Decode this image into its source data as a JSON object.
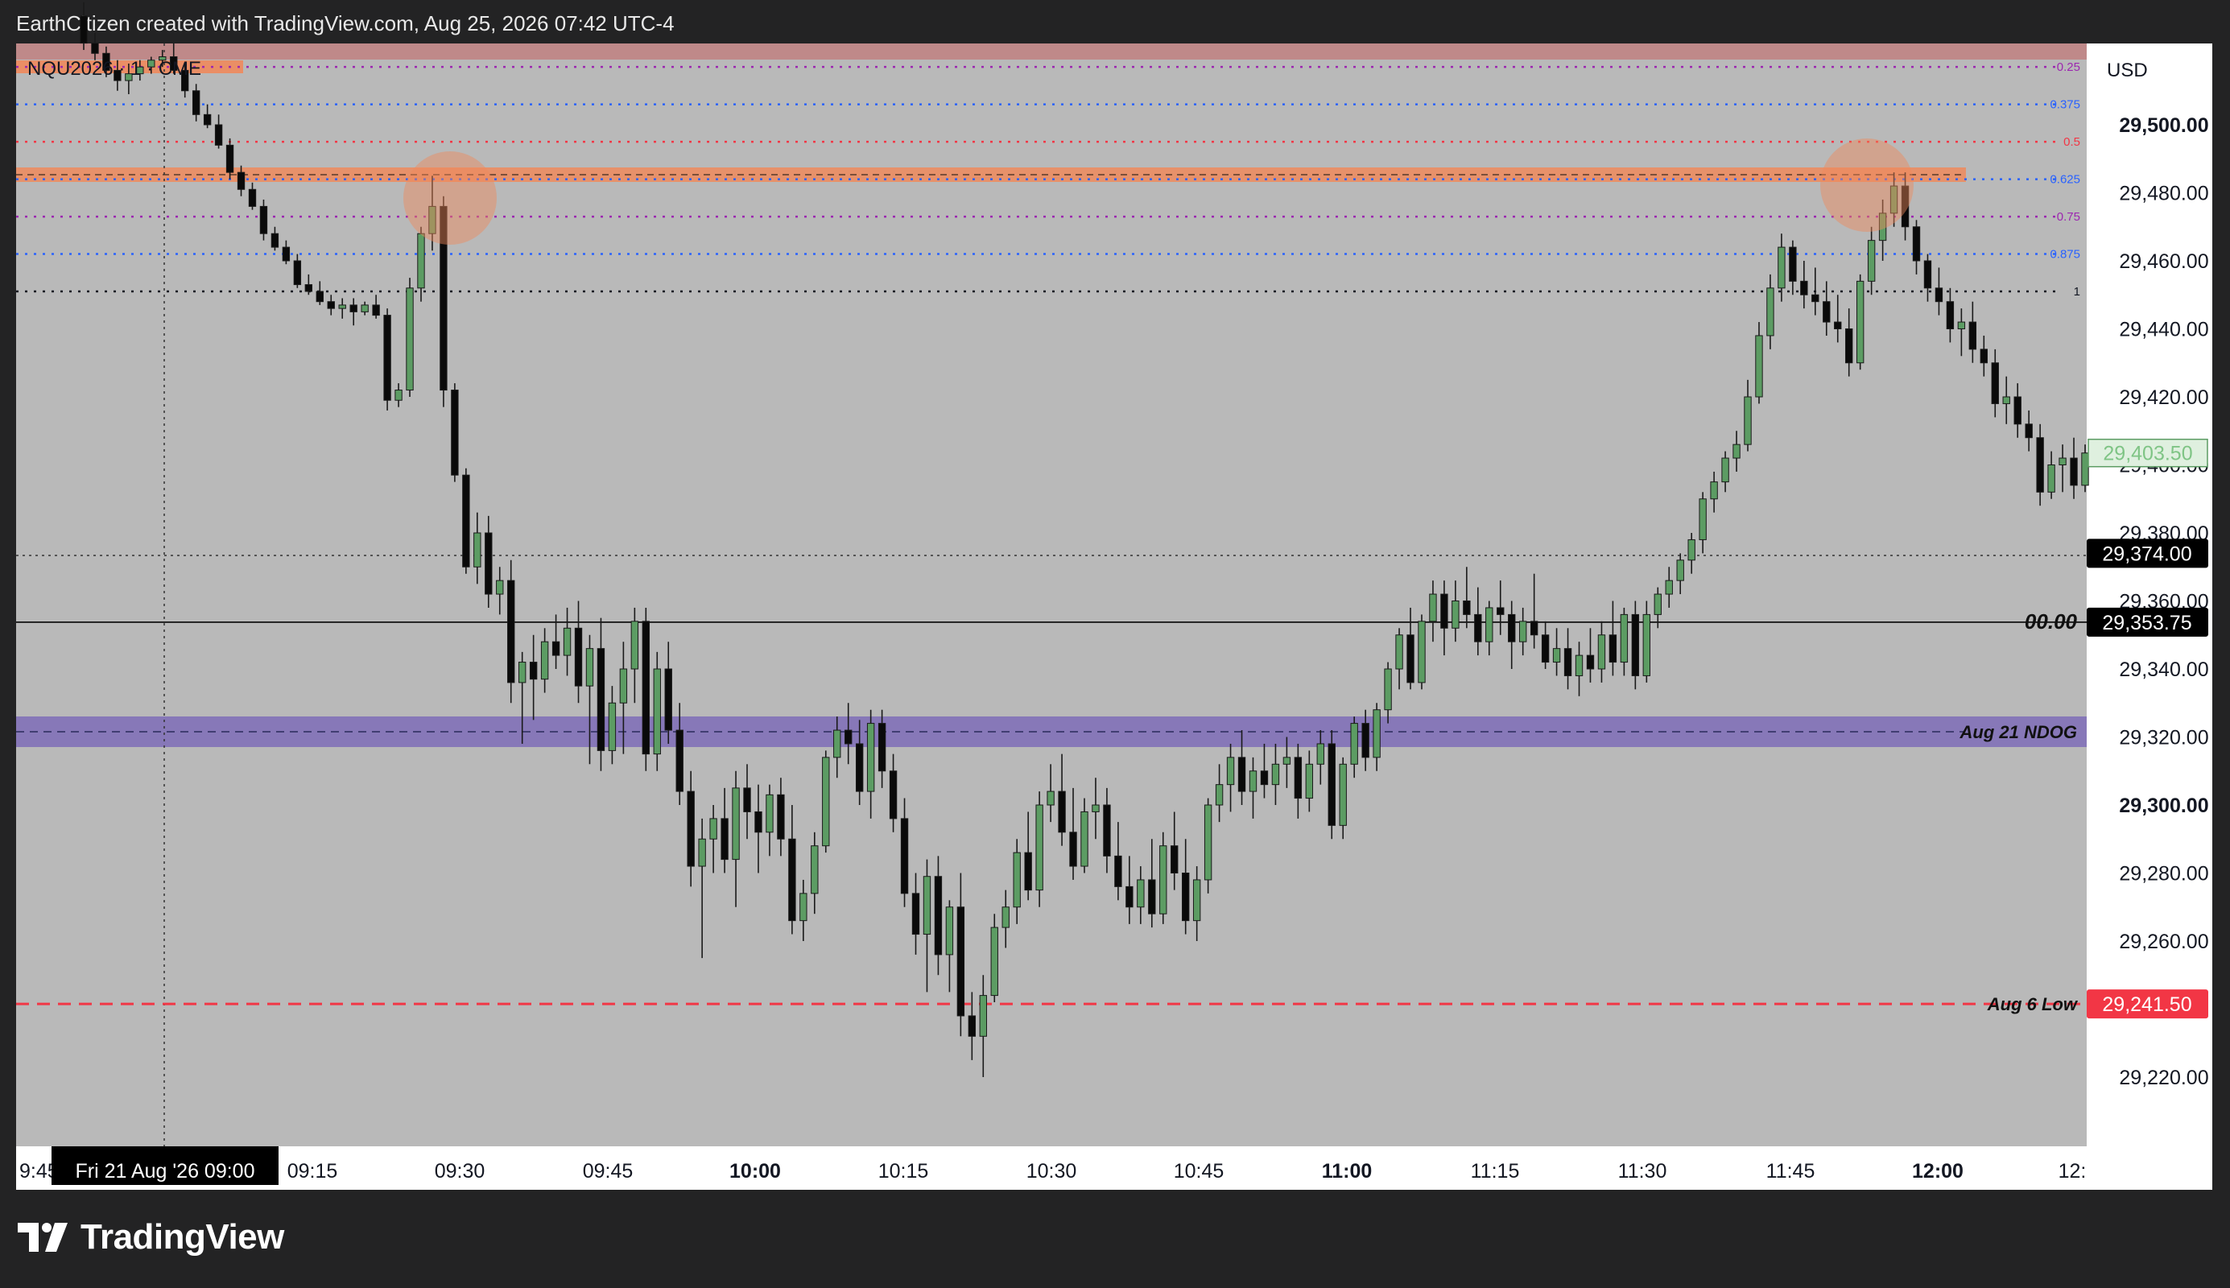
{
  "header": {
    "attribution": "EarthCitizen created with TradingView.com, Aug 25, 2026 07:42 UTC-4"
  },
  "symbol": {
    "label": "NQU2026 · 1 · CME"
  },
  "currency_button": {
    "label": "USD"
  },
  "brand": {
    "name": "TradingView"
  },
  "colors": {
    "bull": "#5c9c63",
    "bear": "#0a0a0a",
    "bg_plot": "#b9b9b9",
    "ndog": "#7a68b8",
    "aug6low": "#f23645",
    "orange_zone": "#ef8a5c",
    "top_zone": "#c08080"
  },
  "chart_data": {
    "type": "candlestick",
    "ylim": [
      29200,
      29535
    ],
    "x_labels": [
      "9:45",
      "Fri 21 Aug '26  09:00",
      "09:15",
      "09:30",
      "09:45",
      "10:00",
      "10:15",
      "10:30",
      "10:45",
      "11:00",
      "11:15",
      "11:30",
      "11:45",
      "12:00",
      "12:"
    ],
    "y_ticks": [
      "29,500.00",
      "29,480.00",
      "29,460.00",
      "29,440.00",
      "29,420.00",
      "29,400.00",
      "29,380.00",
      "29,360.00",
      "29,340.00",
      "29,320.00",
      "29,300.00",
      "29,280.00",
      "29,260.00",
      "29,220.00"
    ],
    "last_price": "29,403.50",
    "price_labels": [
      {
        "text": "29,374.00",
        "value": 29374.0,
        "style": "dark"
      },
      {
        "text": "29,353.75",
        "value": 29353.75,
        "style": "dark"
      },
      {
        "text": "29,241.50",
        "value": 29241.5,
        "style": "red"
      }
    ],
    "level_labels": [
      {
        "text": "00.00",
        "value": 29353.75
      },
      {
        "text": "Aug 21 NDOG",
        "value": 29321.5
      },
      {
        "text": "Aug 6 Low",
        "value": 29241.5
      }
    ],
    "fib_levels": [
      {
        "label": "0.25",
        "value": 29517,
        "color": "#9c27b0"
      },
      {
        "label": "0.375",
        "value": 29506,
        "color": "#2962ff"
      },
      {
        "label": "0.5",
        "value": 29495,
        "color": "#f23645"
      },
      {
        "label": "0.625",
        "value": 29484,
        "color": "#2962ff"
      },
      {
        "label": "0.75",
        "value": 29473,
        "color": "#9c27b0"
      },
      {
        "label": "0.875",
        "value": 29462,
        "color": "#2962ff"
      },
      {
        "label": "1",
        "value": 29451,
        "color": "#131722"
      }
    ],
    "candles": [
      [
        29532,
        29536,
        29522,
        29524
      ],
      [
        29524,
        29527,
        29519,
        29521
      ],
      [
        29521,
        29523,
        29514,
        29516
      ],
      [
        29516,
        29519,
        29510,
        29513
      ],
      [
        29513,
        29518,
        29509,
        29515
      ],
      [
        29515,
        29519,
        29513,
        29517
      ],
      [
        29517,
        29520,
        29515,
        29519
      ],
      [
        29519,
        29522,
        29517,
        29520
      ],
      [
        29520,
        29524,
        29515,
        29516
      ],
      [
        29516,
        29518,
        29508,
        29510
      ],
      [
        29510,
        29512,
        29501,
        29503
      ],
      [
        29503,
        29506,
        29499,
        29500
      ],
      [
        29500,
        29503,
        29493,
        29494
      ],
      [
        29494,
        29496,
        29484,
        29486
      ],
      [
        29486,
        29488,
        29479,
        29481
      ],
      [
        29481,
        29483,
        29475,
        29476
      ],
      [
        29476,
        29478,
        29466,
        29468
      ],
      [
        29468,
        29470,
        29463,
        29464
      ],
      [
        29464,
        29466,
        29459,
        29460
      ],
      [
        29460,
        29462,
        29452,
        29453
      ],
      [
        29453,
        29456,
        29450,
        29451
      ],
      [
        29451,
        29454,
        29447,
        29448
      ],
      [
        29448,
        29450,
        29444,
        29446
      ],
      [
        29446,
        29449,
        29443,
        29447
      ],
      [
        29447,
        29449,
        29441,
        29445
      ],
      [
        29445,
        29448,
        29444,
        29447
      ],
      [
        29447,
        29450,
        29443,
        29444
      ],
      [
        29444,
        29446,
        29416,
        29419
      ],
      [
        29419,
        29424,
        29417,
        29422
      ],
      [
        29422,
        29455,
        29420,
        29452
      ],
      [
        29452,
        29470,
        29448,
        29468
      ],
      [
        29468,
        29485,
        29463,
        29476
      ],
      [
        29476,
        29479,
        29417,
        29422
      ],
      [
        29422,
        29424,
        29395,
        29397
      ],
      [
        29397,
        29399,
        29368,
        29370
      ],
      [
        29370,
        29386,
        29365,
        29380
      ],
      [
        29380,
        29385,
        29358,
        29362
      ],
      [
        29362,
        29370,
        29356,
        29366
      ],
      [
        29366,
        29372,
        29330,
        29336
      ],
      [
        29336,
        29345,
        29318,
        29342
      ],
      [
        29342,
        29350,
        29325,
        29337
      ],
      [
        29337,
        29352,
        29333,
        29348
      ],
      [
        29348,
        29356,
        29340,
        29344
      ],
      [
        29344,
        29358,
        29338,
        29352
      ],
      [
        29352,
        29360,
        29330,
        29335
      ],
      [
        29335,
        29350,
        29312,
        29346
      ],
      [
        29346,
        29355,
        29310,
        29316
      ],
      [
        29316,
        29335,
        29312,
        29330
      ],
      [
        29330,
        29348,
        29315,
        29340
      ],
      [
        29340,
        29358,
        29330,
        29354
      ],
      [
        29354,
        29358,
        29310,
        29315
      ],
      [
        29315,
        29345,
        29310,
        29340
      ],
      [
        29340,
        29348,
        29318,
        29322
      ],
      [
        29322,
        29330,
        29300,
        29304
      ],
      [
        29304,
        29310,
        29276,
        29282
      ],
      [
        29282,
        29296,
        29255,
        29290
      ],
      [
        29290,
        29300,
        29280,
        29296
      ],
      [
        29296,
        29305,
        29280,
        29284
      ],
      [
        29284,
        29310,
        29270,
        29305
      ],
      [
        29305,
        29312,
        29290,
        29298
      ],
      [
        29298,
        29306,
        29280,
        29292
      ],
      [
        29292,
        29306,
        29285,
        29303
      ],
      [
        29303,
        29308,
        29285,
        29290
      ],
      [
        29290,
        29300,
        29262,
        29266
      ],
      [
        29266,
        29278,
        29260,
        29274
      ],
      [
        29274,
        29292,
        29268,
        29288
      ],
      [
        29288,
        29316,
        29286,
        29314
      ],
      [
        29314,
        29326,
        29308,
        29322
      ],
      [
        29322,
        29330,
        29312,
        29318
      ],
      [
        29318,
        29325,
        29300,
        29304
      ],
      [
        29304,
        29328,
        29296,
        29324
      ],
      [
        29324,
        29328,
        29305,
        29310
      ],
      [
        29310,
        29315,
        29292,
        29296
      ],
      [
        29296,
        29302,
        29270,
        29274
      ],
      [
        29274,
        29280,
        29256,
        29262
      ],
      [
        29262,
        29284,
        29245,
        29279
      ],
      [
        29279,
        29285,
        29250,
        29256
      ],
      [
        29256,
        29272,
        29245,
        29270
      ],
      [
        29270,
        29280,
        29232,
        29238
      ],
      [
        29238,
        29245,
        29225,
        29232
      ],
      [
        29232,
        29250,
        29220,
        29244
      ],
      [
        29244,
        29268,
        29242,
        29264
      ],
      [
        29264,
        29275,
        29258,
        29270
      ],
      [
        29270,
        29290,
        29265,
        29286
      ],
      [
        29286,
        29298,
        29272,
        29275
      ],
      [
        29275,
        29304,
        29270,
        29300
      ],
      [
        29300,
        29312,
        29295,
        29304
      ],
      [
        29304,
        29315,
        29288,
        29292
      ],
      [
        29292,
        29305,
        29278,
        29282
      ],
      [
        29282,
        29302,
        29280,
        29298
      ],
      [
        29298,
        29308,
        29290,
        29300
      ],
      [
        29300,
        29305,
        29280,
        29285
      ],
      [
        29285,
        29295,
        29272,
        29276
      ],
      [
        29276,
        29285,
        29265,
        29270
      ],
      [
        29270,
        29282,
        29265,
        29278
      ],
      [
        29278,
        29290,
        29264,
        29268
      ],
      [
        29268,
        29292,
        29265,
        29288
      ],
      [
        29288,
        29298,
        29275,
        29280
      ],
      [
        29280,
        29290,
        29262,
        29266
      ],
      [
        29266,
        29282,
        29260,
        29278
      ],
      [
        29278,
        29302,
        29274,
        29300
      ],
      [
        29300,
        29312,
        29295,
        29306
      ],
      [
        29306,
        29318,
        29298,
        29314
      ],
      [
        29314,
        29322,
        29300,
        29304
      ],
      [
        29304,
        29314,
        29296,
        29310
      ],
      [
        29310,
        29318,
        29302,
        29306
      ],
      [
        29306,
        29318,
        29300,
        29312
      ],
      [
        29312,
        29320,
        29305,
        29314
      ],
      [
        29314,
        29318,
        29296,
        29302
      ],
      [
        29302,
        29316,
        29298,
        29312
      ],
      [
        29312,
        29322,
        29306,
        29318
      ],
      [
        29318,
        29322,
        29290,
        29294
      ],
      [
        29294,
        29314,
        29290,
        29312
      ],
      [
        29312,
        29326,
        29308,
        29324
      ],
      [
        29324,
        29328,
        29310,
        29314
      ],
      [
        29314,
        29330,
        29310,
        29328
      ],
      [
        29328,
        29342,
        29324,
        29340
      ],
      [
        29340,
        29352,
        29334,
        29350
      ],
      [
        29350,
        29358,
        29334,
        29336
      ],
      [
        29336,
        29356,
        29334,
        29354
      ],
      [
        29354,
        29366,
        29348,
        29362
      ],
      [
        29362,
        29366,
        29344,
        29352
      ],
      [
        29352,
        29366,
        29348,
        29360
      ],
      [
        29360,
        29370,
        29352,
        29356
      ],
      [
        29356,
        29364,
        29344,
        29348
      ],
      [
        29348,
        29360,
        29344,
        29358
      ],
      [
        29358,
        29366,
        29350,
        29356
      ],
      [
        29356,
        29360,
        29340,
        29348
      ],
      [
        29348,
        29358,
        29344,
        29354
      ],
      [
        29354,
        29368,
        29346,
        29350
      ],
      [
        29350,
        29354,
        29340,
        29342
      ],
      [
        29342,
        29352,
        29338,
        29346
      ],
      [
        29346,
        29352,
        29334,
        29338
      ],
      [
        29338,
        29348,
        29332,
        29344
      ],
      [
        29344,
        29352,
        29336,
        29340
      ],
      [
        29340,
        29354,
        29336,
        29350
      ],
      [
        29350,
        29360,
        29338,
        29342
      ],
      [
        29342,
        29358,
        29338,
        29356
      ],
      [
        29356,
        29360,
        29334,
        29338
      ],
      [
        29338,
        29360,
        29336,
        29356
      ],
      [
        29356,
        29364,
        29352,
        29362
      ],
      [
        29362,
        29370,
        29358,
        29366
      ],
      [
        29366,
        29374,
        29362,
        29372
      ],
      [
        29372,
        29380,
        29368,
        29378
      ],
      [
        29378,
        29392,
        29374,
        29390
      ],
      [
        29390,
        29398,
        29386,
        29395
      ],
      [
        29395,
        29404,
        29392,
        29402
      ],
      [
        29402,
        29410,
        29398,
        29406
      ],
      [
        29406,
        29425,
        29404,
        29420
      ],
      [
        29420,
        29442,
        29418,
        29438
      ],
      [
        29438,
        29456,
        29434,
        29452
      ],
      [
        29452,
        29468,
        29448,
        29464
      ],
      [
        29464,
        29466,
        29450,
        29454
      ],
      [
        29454,
        29460,
        29446,
        29450
      ],
      [
        29450,
        29458,
        29444,
        29448
      ],
      [
        29448,
        29454,
        29438,
        29442
      ],
      [
        29442,
        29450,
        29436,
        29440
      ],
      [
        29440,
        29446,
        29426,
        29430
      ],
      [
        29430,
        29456,
        29428,
        29454
      ],
      [
        29454,
        29470,
        29450,
        29466
      ],
      [
        29466,
        29478,
        29460,
        29474
      ],
      [
        29474,
        29486,
        29470,
        29482
      ],
      [
        29482,
        29486,
        29466,
        29470
      ],
      [
        29470,
        29472,
        29456,
        29460
      ],
      [
        29460,
        29462,
        29448,
        29452
      ],
      [
        29452,
        29458,
        29444,
        29448
      ],
      [
        29448,
        29452,
        29436,
        29440
      ],
      [
        29440,
        29446,
        29432,
        29442
      ],
      [
        29442,
        29448,
        29430,
        29434
      ],
      [
        29434,
        29438,
        29426,
        29430
      ],
      [
        29430,
        29434,
        29414,
        29418
      ],
      [
        29418,
        29426,
        29412,
        29420
      ],
      [
        29420,
        29424,
        29408,
        29412
      ],
      [
        29412,
        29416,
        29404,
        29408
      ],
      [
        29408,
        29412,
        29388,
        29392
      ],
      [
        29392,
        29404,
        29390,
        29400
      ],
      [
        29400,
        29406,
        29392,
        29402
      ],
      [
        29402,
        29408,
        29390,
        29394
      ],
      [
        29394,
        29406,
        29392,
        29403.5
      ]
    ]
  }
}
